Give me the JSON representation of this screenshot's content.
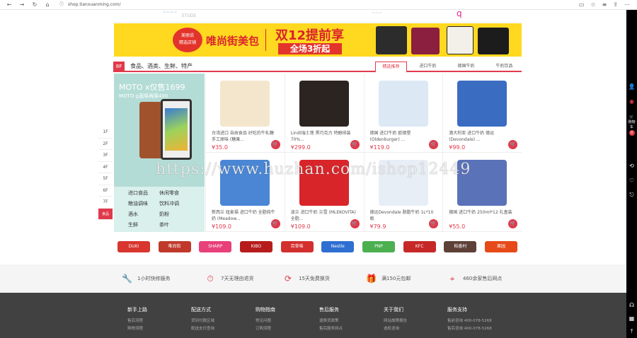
{
  "browser": {
    "url": "shop.tianxuanming.com/"
  },
  "banner": {
    "badge_line1": "美丽说",
    "badge_line2": "精选店铺",
    "title": "唯尚街美包",
    "headline": "双12提前享",
    "subline": "全场3折起"
  },
  "category": {
    "floor_label": "8F",
    "name": "食品、酒类、生鲜、特产",
    "tabs": [
      "精选推荐",
      "进口牛奶",
      "德国牛奶",
      "牛奶饮品"
    ]
  },
  "floor_nav": [
    "1F",
    "2F",
    "3F",
    "4F",
    "5F",
    "6F",
    "7F",
    "食品"
  ],
  "left_panel": {
    "title": "MOTO x仅售1699",
    "subtitle": "MOTO g直降再降400",
    "links": [
      "进口食品",
      "休闲零食",
      "粮油调味",
      "饮料冲调",
      "酒水",
      "奶粉",
      "生鲜",
      "茶叶"
    ]
  },
  "products": [
    {
      "name": "台湾进口 自由食品 好吃的牛轧糖 手工原味 (糖果...",
      "price": "¥35.0",
      "color": "#f3e6cc"
    },
    {
      "name": "Lindt瑞士莲 黑巧克力 特醇排装 70%...",
      "price": "¥299.0",
      "color": "#2b2420"
    },
    {
      "name": "德国 进口牛奶 欧德堡 (Oldenburger) ...",
      "price": "¥119.0",
      "color": "#dce9f5"
    },
    {
      "name": "澳大利亚 进口牛奶 德运 (Devondale) ...",
      "price": "¥99.0",
      "color": "#3a6cc2"
    },
    {
      "name": "新西兰 纽麦福 进口牛奶 全脂纯牛奶 (Meadow...",
      "price": "¥109.0",
      "color": "#4a86d4"
    },
    {
      "name": "波兰 进口牛奶 兰雪 (MLEKOVITA) 全脂...",
      "price": "¥109.0",
      "color": "#d8252a"
    },
    {
      "name": "德运Devondale 脱脂牛奶 1L*10瓶",
      "price": "¥79.9",
      "color": "#e8eef6"
    },
    {
      "name": "德国 进口牛奶 250ml*12 礼盒装",
      "price": "¥55.0",
      "color": "#5a72b8"
    }
  ],
  "brands": [
    {
      "name": "DUKI",
      "color": "#d8362f"
    },
    {
      "name": "唯尚街",
      "color": "#c0392b"
    },
    {
      "name": "SHARP",
      "color": "#e8407a"
    },
    {
      "name": "KIBO",
      "color": "#b71c1c"
    },
    {
      "name": "百草味",
      "color": "#d32f2f"
    },
    {
      "name": "Nestle",
      "color": "#2e6fd1"
    },
    {
      "name": "PNP",
      "color": "#4caf50"
    },
    {
      "name": "KFC",
      "color": "#c62828"
    },
    {
      "name": "稻香村",
      "color": "#5d4037"
    },
    {
      "name": "果园",
      "color": "#e64a19"
    }
  ],
  "services": [
    "1小时快修服务",
    "7天无理由退货",
    "15天免费换货",
    "满150元包邮",
    "460余家售后网点"
  ],
  "footer": [
    {
      "title": "新手上路",
      "items": [
        "售后流程",
        "购物流程"
      ]
    },
    {
      "title": "配送方式",
      "items": [
        "货到付款区域",
        "配送支付查询"
      ]
    },
    {
      "title": "购物指南",
      "items": [
        "常见问题",
        "订购流程"
      ]
    },
    {
      "title": "售后服务",
      "items": [
        "退换货政策",
        "售后服务网点"
      ]
    },
    {
      "title": "关于我们",
      "items": [
        "网站故障报告",
        "选机咨询"
      ]
    },
    {
      "title": "服务支持",
      "items": [
        "售前咨询 400-078-5268",
        "售后咨询 400-078-5268"
      ]
    }
  ],
  "sidebar": {
    "cart_label": "购物车",
    "cart_count": "0"
  },
  "watermark": "https://www.huzhan.com/ishop12449"
}
